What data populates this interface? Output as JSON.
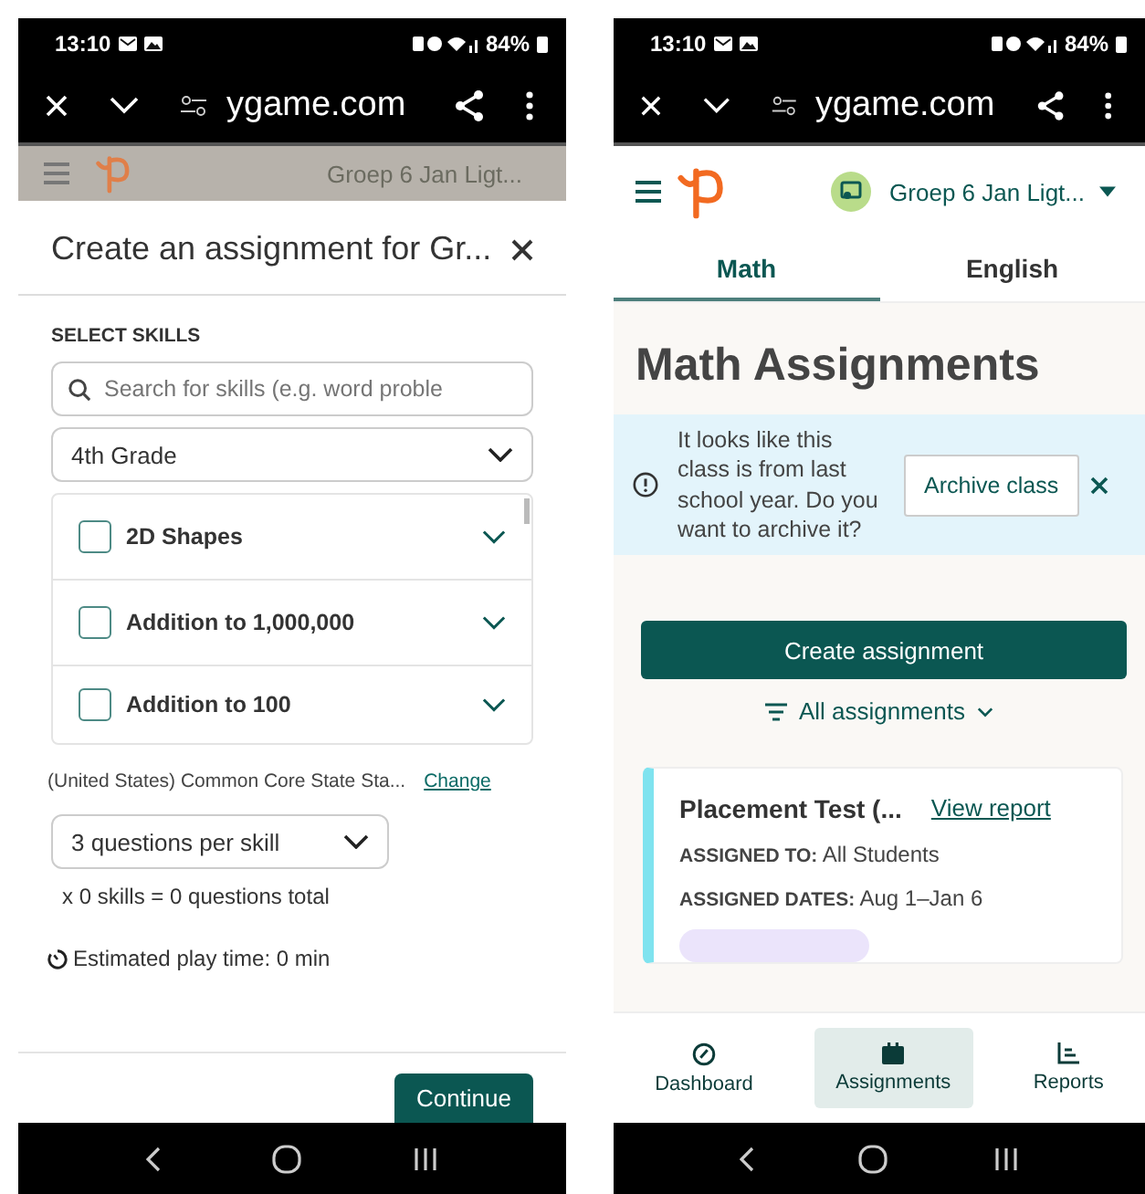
{
  "left_screen": {
    "status_bar": {
      "time": "13:10",
      "battery": "84%"
    },
    "browser_bar": {
      "url": "ygame.com"
    },
    "backdrop_header": {
      "class_name": "Groep 6 Jan Ligt..."
    },
    "modal": {
      "title": "Create an assignment for Gr...",
      "section_label": "SELECT SKILLS",
      "search": {
        "placeholder": "Search for skills (e.g. word proble"
      },
      "grade_select": "4th Grade",
      "skills": [
        {
          "label": "2D Shapes",
          "checked": false
        },
        {
          "label": "Addition to 1,000,000",
          "checked": false
        },
        {
          "label": "Addition to 100",
          "checked": false
        }
      ],
      "standard": "(United States) Common Core State Sta...",
      "change_link": "Change",
      "questions_select": "3 questions per skill",
      "total": "x 0 skills = 0 questions total",
      "play_time": "Estimated play time: 0 min",
      "continue_button": "Continue"
    }
  },
  "right_screen": {
    "status_bar": {
      "time": "13:10",
      "battery": "84%"
    },
    "browser_bar": {
      "url": "ygame.com"
    },
    "header": {
      "class_name": "Groep 6 Jan Ligt..."
    },
    "tabs": [
      {
        "label": "Math",
        "selected": true
      },
      {
        "label": "English",
        "selected": false
      }
    ],
    "title": "Math Assignments",
    "banner": {
      "text": "It looks like this class is from last school year. Do you want to archive it?",
      "button": "Archive class"
    },
    "create_button": "Create assignment",
    "filter": "All assignments",
    "card": {
      "title": "Placement Test (...",
      "link": "View report",
      "rows": [
        {
          "label": "ASSIGNED TO:",
          "value": "All Students"
        },
        {
          "label": "ASSIGNED DATES:",
          "value": "Aug 1–Jan 6"
        }
      ]
    },
    "bottom_nav": [
      {
        "label": "Dashboard",
        "selected": false
      },
      {
        "label": "Assignments",
        "selected": true
      },
      {
        "label": "Reports",
        "selected": false
      }
    ]
  }
}
